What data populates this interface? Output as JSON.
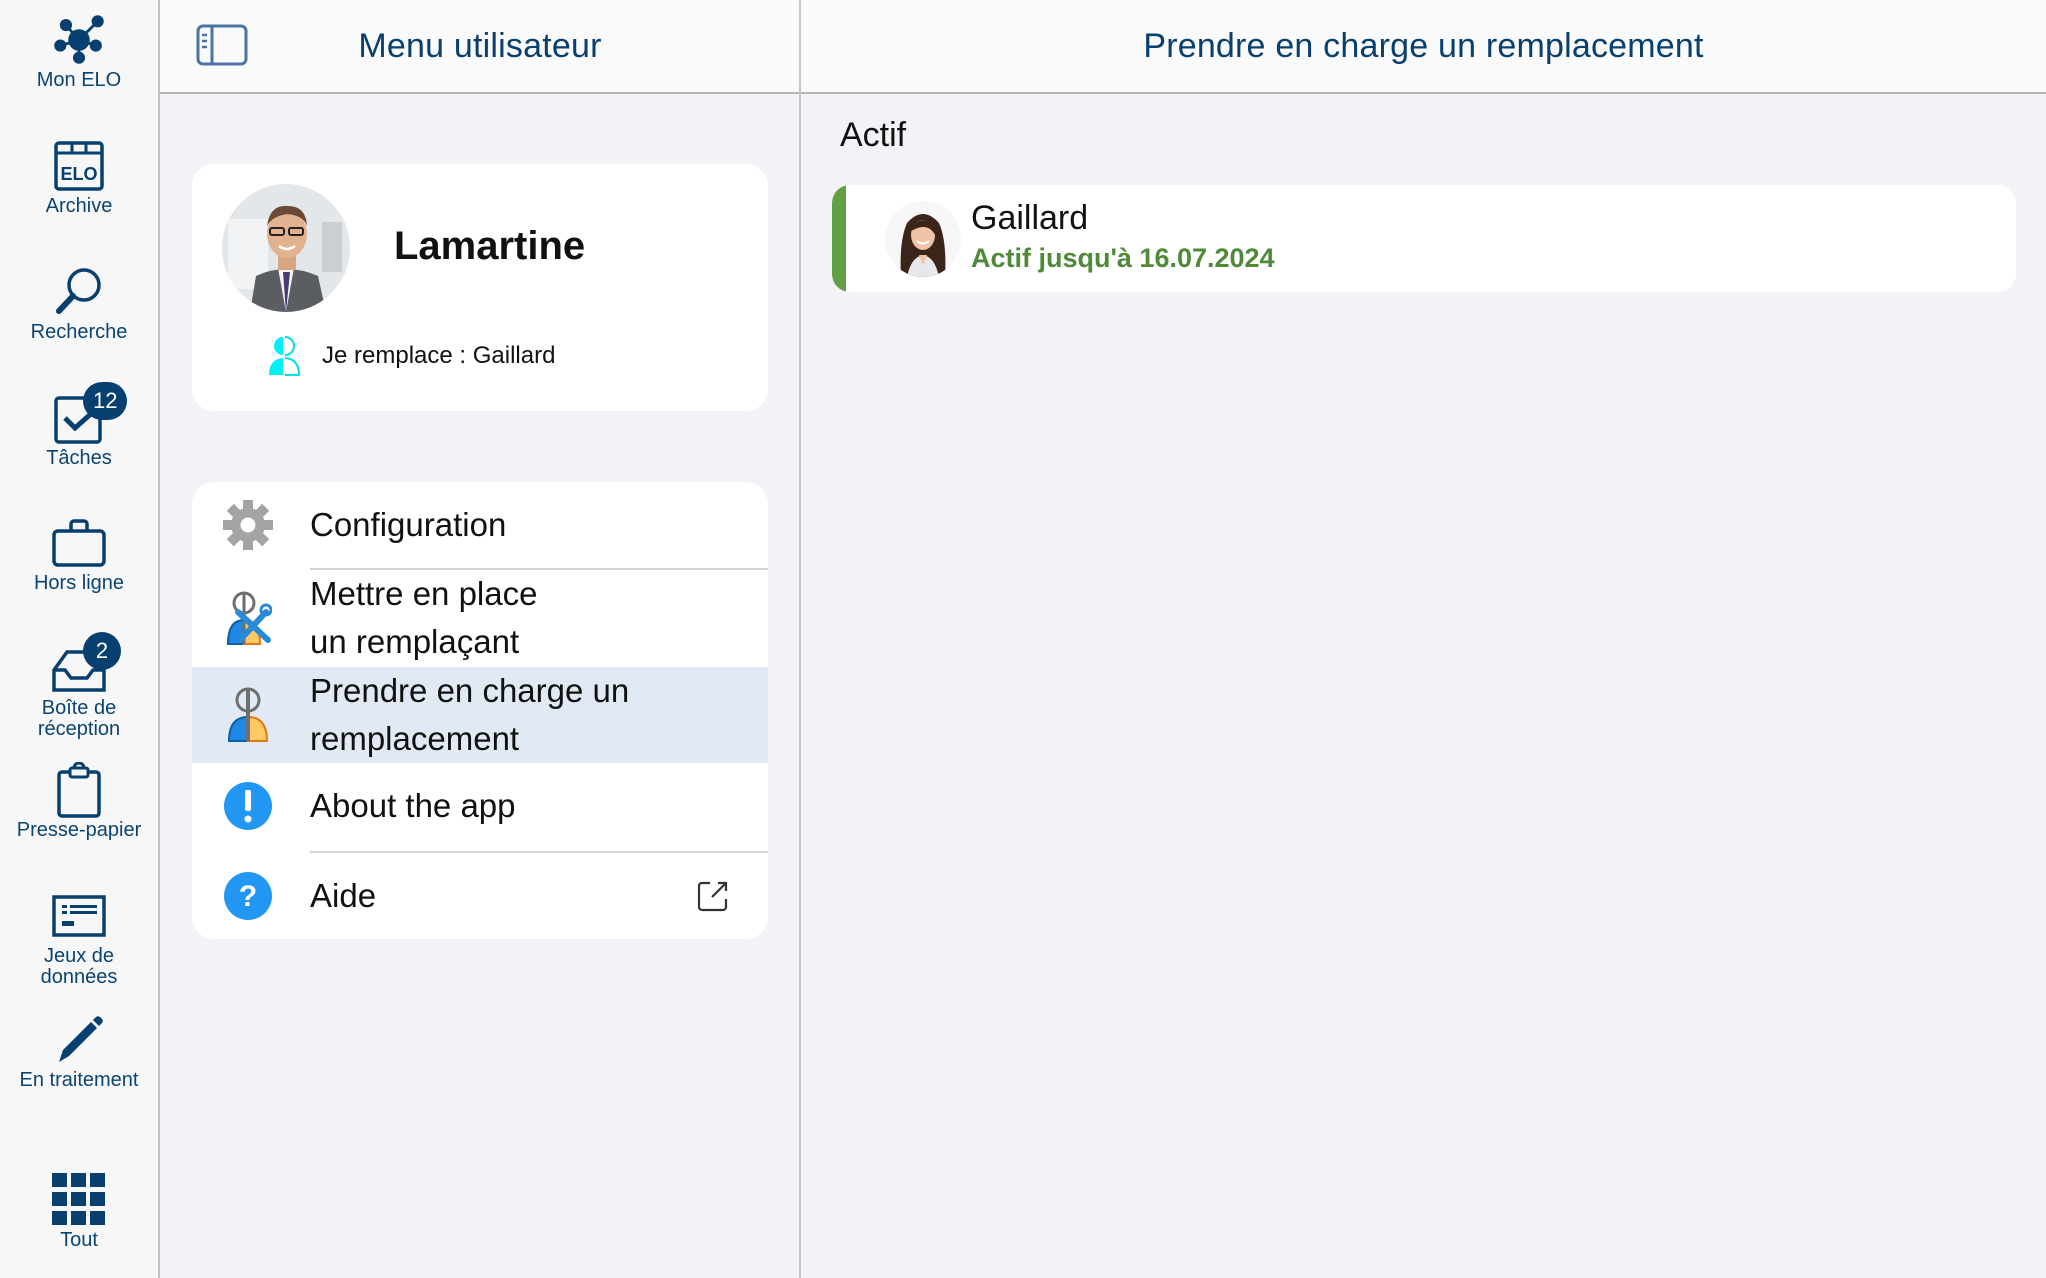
{
  "sidebar": {
    "items": [
      {
        "label": "Mon ELO",
        "icon": "network-hub-icon"
      },
      {
        "label": "Archive",
        "icon": "elo-archive-icon"
      },
      {
        "label": "Recherche",
        "icon": "search-icon"
      },
      {
        "label": "Tâches",
        "icon": "task-check-icon",
        "badge": "12"
      },
      {
        "label": "Hors ligne",
        "icon": "briefcase-icon"
      },
      {
        "label": "Boîte de réception",
        "label_line1": "Boîte de",
        "label_line2": "réception",
        "icon": "inbox-icon",
        "badge": "2"
      },
      {
        "label": "Presse-papier",
        "icon": "clipboard-icon"
      },
      {
        "label": "Jeux de données",
        "label_line1": "Jeux de",
        "label_line2": "données",
        "icon": "dataset-form-icon"
      },
      {
        "label": "En traitement",
        "icon": "pencil-icon"
      },
      {
        "label": "Tout",
        "icon": "grid-apps-icon"
      }
    ]
  },
  "middle": {
    "header_title": "Menu utilisateur",
    "profile": {
      "name": "Lamartine",
      "replacing_text": "Je remplace : Gaillard"
    },
    "menu": [
      {
        "label": "Configuration",
        "icon": "gear-icon"
      },
      {
        "label_line1": "Mettre en place",
        "label_line2": "un remplaçant",
        "icon": "substitute-setup-icon"
      },
      {
        "label_line1": "Prendre en charge un",
        "label_line2": "remplacement",
        "icon": "substitute-takeover-icon",
        "active": true
      },
      {
        "label": "About the app",
        "icon": "info-exclamation-icon"
      },
      {
        "label": "Aide",
        "icon": "help-question-icon",
        "trailing_icon": "external-link-icon"
      }
    ]
  },
  "right": {
    "header_title": "Prendre en charge un remplacement",
    "section_label": "Actif",
    "substitutions": [
      {
        "name": "Gaillard",
        "status": "Actif jusqu'à 16.07.2024",
        "status_color": "#4e8a37"
      }
    ]
  },
  "colors": {
    "brand": "#073f6e",
    "active_bar": "#62a044",
    "active_row": "#e1eaf4",
    "background": "#f2f2f7",
    "info_blue": "#2196f3"
  }
}
